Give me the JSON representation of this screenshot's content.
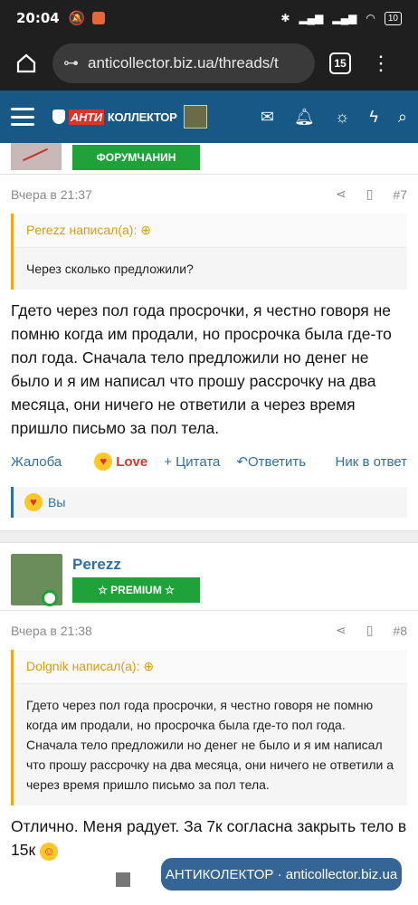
{
  "status": {
    "time": "20:04",
    "battery": "10"
  },
  "browser": {
    "url": "anticollector.biz.ua/threads/t",
    "tab_count": "15"
  },
  "site": {
    "logo_anti": "АНТИ",
    "logo_rest": "КОЛЛЕКТОР"
  },
  "post7": {
    "rank": "ФОРУМЧАНИН",
    "time": "Вчера в 21:37",
    "number": "#7",
    "quote_author": "Perezz написал(а):",
    "quote_text": "Через сколько предложили?",
    "message": "Гдето через пол года просрочки, я честно говоря не помню когда им продали, но просрочка была где-то пол года. Сначала тело предложили но денег не было и я им написал что прошу рассрочку на два месяца, они ничего не ответили а через время пришло письмо за пол тела.",
    "report": "Жалоба",
    "love": "Love",
    "quote_link": "+ Цитата",
    "reply": "Ответить",
    "nick": "Ник в ответ",
    "reaction_user": "Вы"
  },
  "post8": {
    "username": "Perezz",
    "rank": "☆ PREMIUM ☆",
    "time": "Вчера в 21:38",
    "number": "#8",
    "quote_author": "Dolgnik написал(а):",
    "quote_text": "Гдето через пол года просрочки, я честно говоря не помню когда им продали, но просрочка была где-то пол года. Сначала тело предложили но денег не было и я им написал что прошу рассрочку на два месяца, они ничего не ответили а через время пришло письмо за пол тела.",
    "message": "Отлично. Меня радует. За 7к согласна закрыть тело в 15к"
  },
  "watermark": {
    "text": "АНТИКОЛЕКТОР · anticollector.biz.ua"
  }
}
